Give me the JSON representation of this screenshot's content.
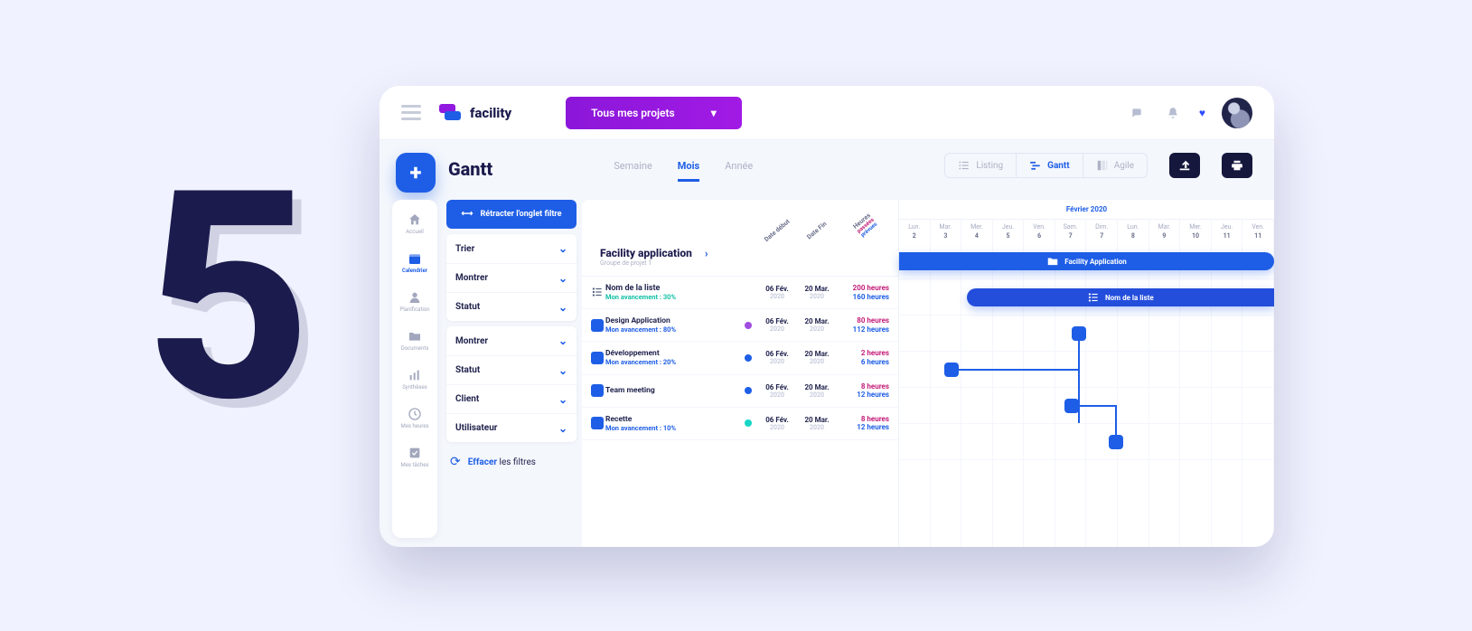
{
  "big_digit": "5",
  "brand": "facility",
  "project_selector": "Tous mes projets",
  "page_title": "Gantt",
  "time_tabs": {
    "week": "Semaine",
    "month": "Mois",
    "year": "Année"
  },
  "view_switch": {
    "listing": "Listing",
    "gantt": "Gantt",
    "agile": "Agile"
  },
  "filters": {
    "retract": "Rétracter l'onglet filtre",
    "clear_prefix": "Effacer",
    "clear_rest": " les filtres",
    "rows": [
      "Trier",
      "Montrer",
      "Statut",
      "Montrer",
      "Statut",
      "Client",
      "Utilisateur"
    ]
  },
  "rail": {
    "accueil": "Accueil",
    "calendrier": "Calendrier",
    "planification": "Planification",
    "documents": "Documents",
    "syntheses": "Synthèses",
    "mesheures": "Mes heures",
    "mestaches": "Mes tâches"
  },
  "task_head": {
    "date_debut": "Date début",
    "date_fin": "Date Fin",
    "heures": "Heures",
    "passes": "passées",
    "prevues": "prévues"
  },
  "project": {
    "title": "Facility application",
    "subtitle": "Groupe de projet 1"
  },
  "rows": [
    {
      "kind": "list",
      "name": "Nom de la liste",
      "prog": "Mon avancement : 30%",
      "progColor": "teal",
      "d1": "06 Fév.",
      "y1": "2020",
      "d2": "20 Mar.",
      "y2": "2020",
      "h1": "200 heures",
      "h2": "160 heures"
    },
    {
      "kind": "task",
      "name": "Design Application",
      "prog": "Mon avancement : 80%",
      "progColor": "blue",
      "dot": "purple",
      "d1": "06 Fév.",
      "y1": "2020",
      "d2": "20 Mar.",
      "y2": "2020",
      "h1": "80 heures",
      "h2": "112 heures"
    },
    {
      "kind": "task",
      "name": "Développement",
      "prog": "Mon avancement : 20%",
      "progColor": "blue",
      "dot": "task",
      "d1": "06 Fév.",
      "y1": "2020",
      "d2": "20 Mar.",
      "y2": "2020",
      "h1": "2 heures",
      "h2": "6 heures"
    },
    {
      "kind": "task",
      "name": "Team meeting",
      "prog": "",
      "progColor": "",
      "dot": "task",
      "d1": "06 Fév.",
      "y1": "2020",
      "d2": "20 Mar.",
      "y2": "2020",
      "h1": "8 heures",
      "h2": "12 heures"
    },
    {
      "kind": "task",
      "name": "Recette",
      "prog": "Mon avancement : 10%",
      "progColor": "blue",
      "dot": "teal",
      "d1": "06 Fév.",
      "y1": "2020",
      "d2": "20 Mar.",
      "y2": "2020",
      "h1": "8 heures",
      "h2": "12 heures"
    }
  ],
  "gantt": {
    "month": "Février 2020",
    "days_short": [
      "Lun.",
      "Mar.",
      "Mer.",
      "Jeu.",
      "Ven.",
      "Sam.",
      "Dim.",
      "Lun.",
      "Mar.",
      "Mer.",
      "Jeu.",
      "Ven."
    ],
    "days_num": [
      "2",
      "3",
      "4",
      "5",
      "6",
      "7",
      "7",
      "8",
      "9",
      "10",
      "11",
      "11"
    ],
    "bars": [
      {
        "label": "Facility Application"
      },
      {
        "label": "Nom de la liste"
      }
    ]
  }
}
